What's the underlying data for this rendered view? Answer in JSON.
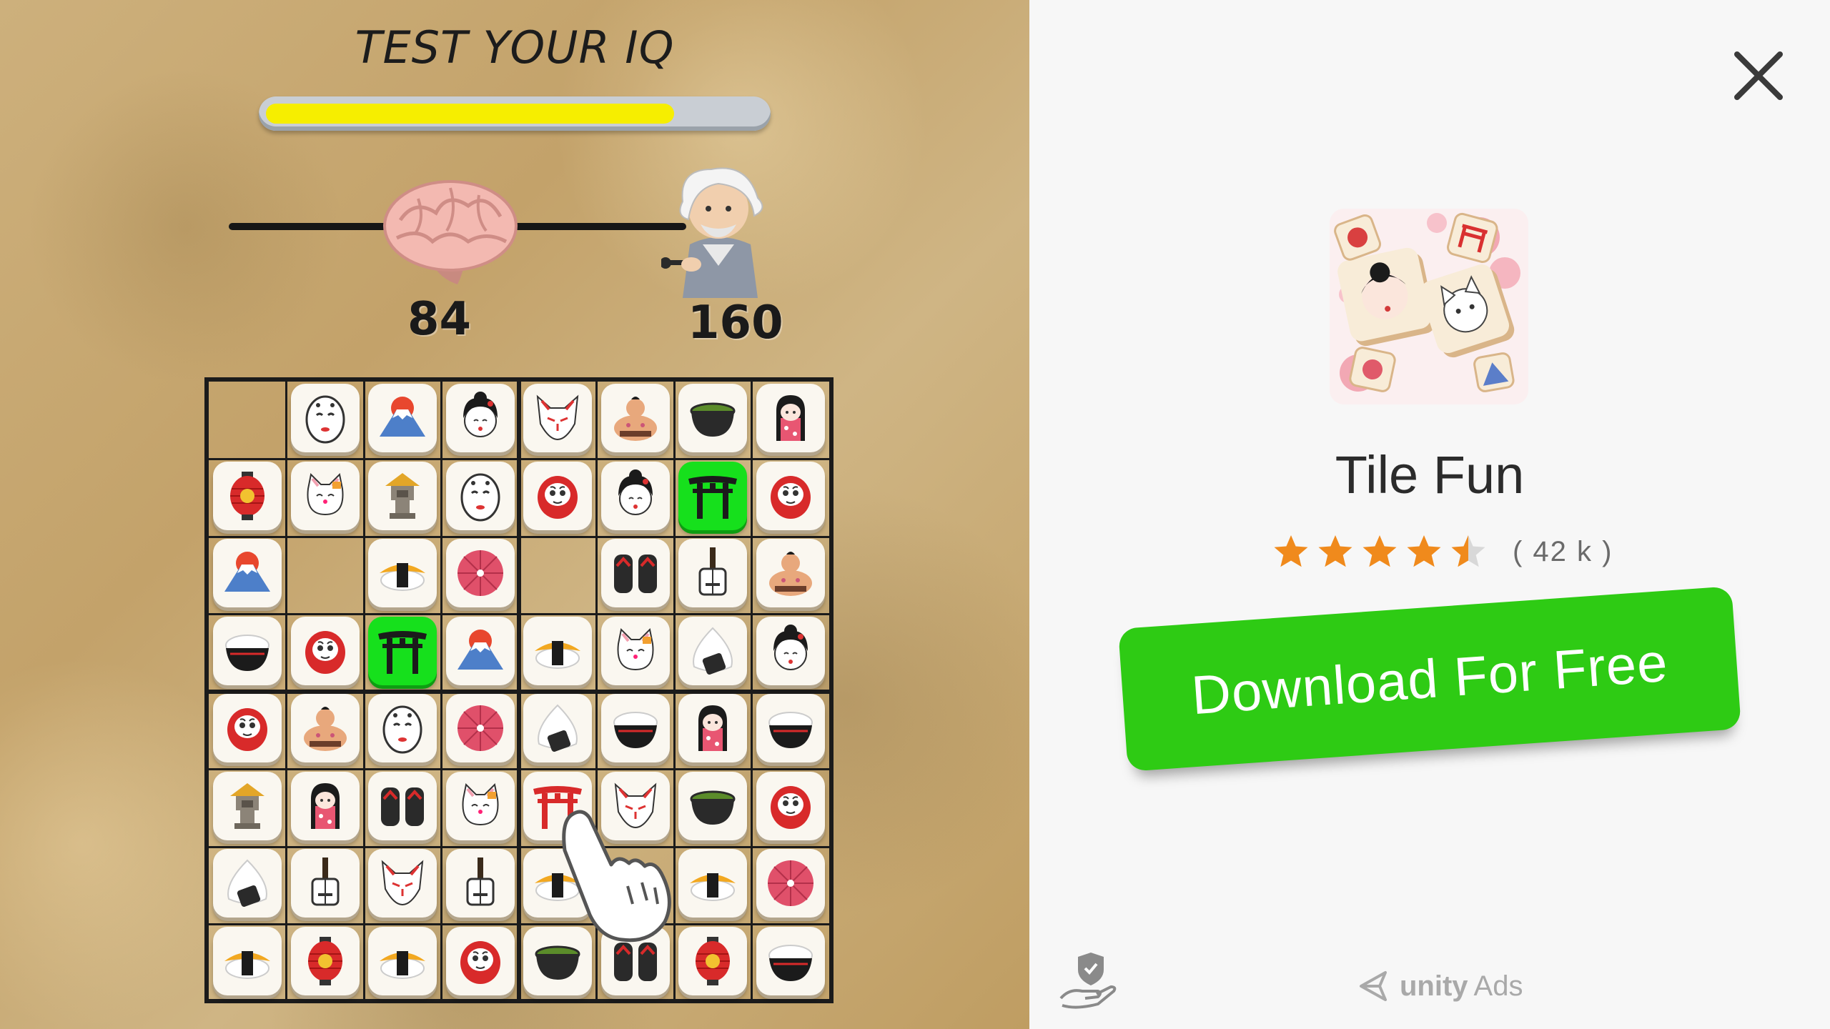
{
  "game": {
    "title": "TEST YOUR IQ",
    "progress": 0.82,
    "iq_current": "84",
    "iq_max": "160",
    "grid": [
      [
        "empty",
        "noh",
        "fuji",
        "geisha",
        "fox",
        "sumo",
        "tea",
        "kokeshi"
      ],
      [
        "lantern",
        "cat",
        "stone-lantern",
        "noh",
        "daruma",
        "geisha",
        "torii-hl",
        "daruma"
      ],
      [
        "fuji",
        "empty",
        "sushi",
        "umbrella",
        "empty",
        "geta",
        "shamisen",
        "sumo"
      ],
      [
        "rice-bowl",
        "daruma",
        "torii-hl",
        "fuji",
        "sushi",
        "cat",
        "onigiri",
        "geisha"
      ],
      [
        "daruma",
        "sumo",
        "noh",
        "umbrella",
        "onigiri",
        "rice-bowl",
        "kokeshi",
        "rice-bowl"
      ],
      [
        "stone-lantern",
        "kokeshi",
        "geta",
        "cat",
        "torii",
        "fox",
        "tea",
        "daruma"
      ],
      [
        "onigiri",
        "shamisen",
        "fox",
        "shamisen",
        "sushi",
        "empty",
        "sushi",
        "umbrella"
      ],
      [
        "sushi",
        "lantern",
        "sushi",
        "daruma",
        "tea",
        "geta",
        "lantern",
        "rice-bowl"
      ]
    ]
  },
  "ad": {
    "app_name": "Tile Fun",
    "rating": 4.5,
    "rating_count": "( 42 k )",
    "download_label": "Download For Free",
    "unity": "unity",
    "ads": "Ads"
  },
  "colors": {
    "star": "#f08a1c",
    "download": "#2ecb14",
    "highlight": "#16e01c",
    "progress": "#f6ee00"
  }
}
